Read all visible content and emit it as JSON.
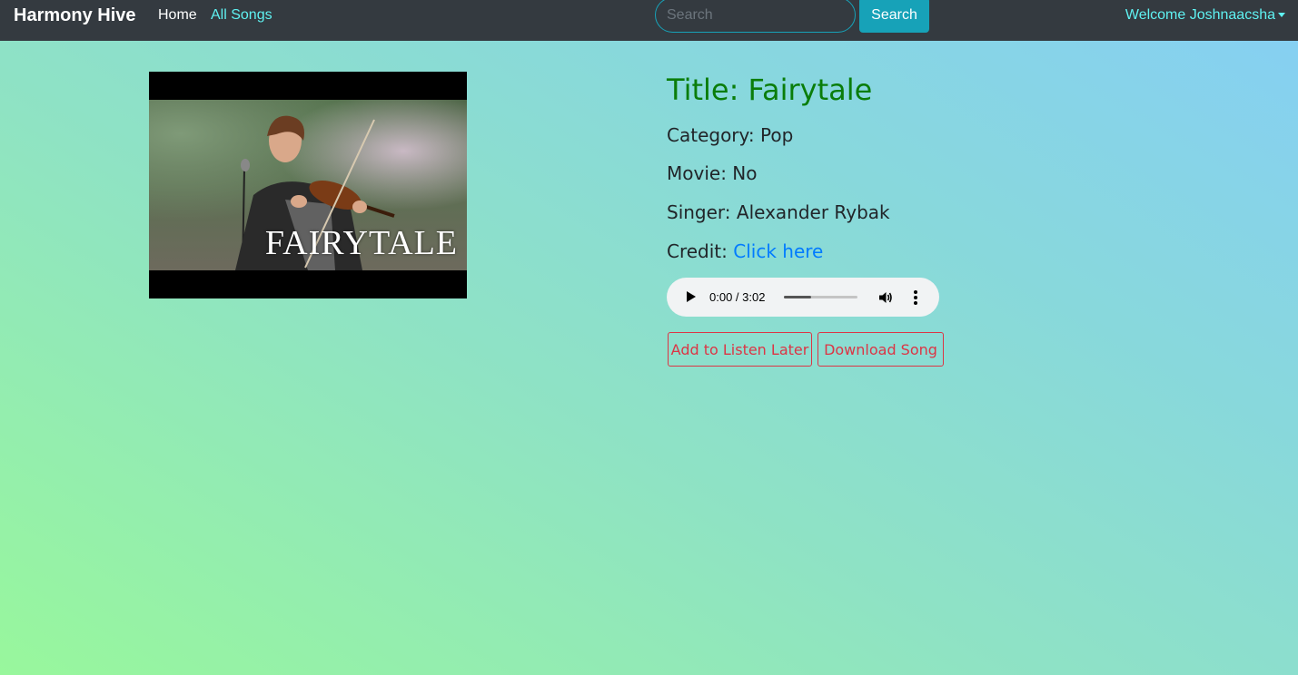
{
  "navbar": {
    "brand": "Harmony Hive",
    "home_label": "Home",
    "all_songs_label": "All Songs",
    "search_placeholder": "Search",
    "search_button": "Search",
    "welcome": "Welcome Joshnaacsha"
  },
  "song": {
    "thumbnail_caption": "FAIRYTALE",
    "title": "Title: Fairytale",
    "category": "Category: Pop",
    "movie": "Movie: No",
    "singer": "Singer: Alexander Rybak",
    "credit_label": "Credit: ",
    "credit_link": "Click here"
  },
  "player": {
    "time": "0:00 / 3:02",
    "buffered_fraction": 0.37
  },
  "actions": {
    "listen_later": "Add to Listen Later",
    "download": "Download Song"
  },
  "colors": {
    "navbar": "#343a40",
    "accent": "#17a2b8",
    "title": "#0a7d0a",
    "link": "#007bff",
    "danger": "#dc3545"
  }
}
